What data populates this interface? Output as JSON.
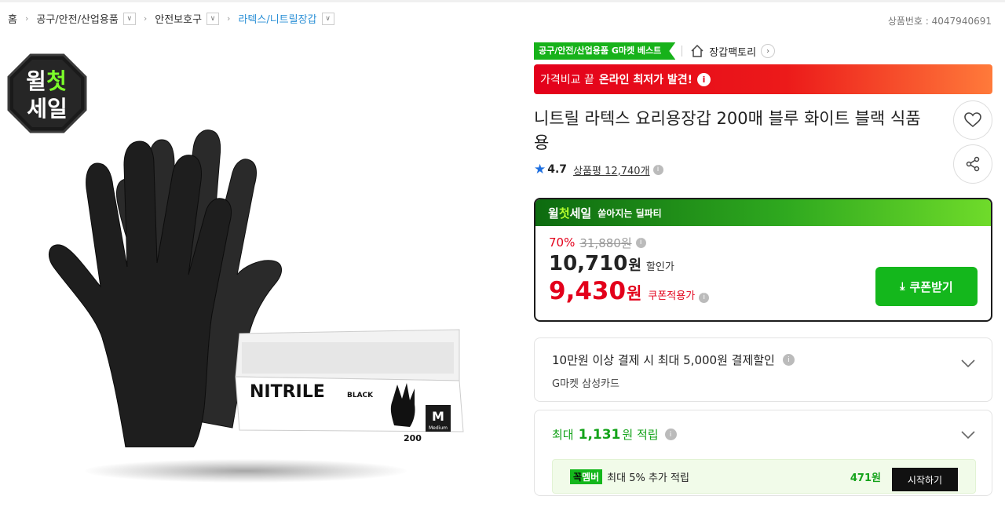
{
  "breadcrumb": {
    "home": "홈",
    "items": [
      {
        "label": "공구/안전/산업용품"
      },
      {
        "label": "안전보호구"
      },
      {
        "label": "라텍스/니트릴장갑"
      }
    ]
  },
  "product_no": "상품번호 : 4047940691",
  "badge": {
    "line1a": "윌",
    "line1b": "첫",
    "line2": "세일"
  },
  "box_label": {
    "brand": "NITRILE",
    "variant": "BLACK",
    "count": "200",
    "size": "M",
    "size_sub": "Medium"
  },
  "best_tag": "공구/안전/산업용품 G마켓 베스트",
  "store": {
    "name": "장갑팩토리"
  },
  "promo": {
    "text": "가격비교 끝",
    "bold": "온라인 최저가 발견!",
    "info": "i"
  },
  "title": "니트릴 라텍스 요리용장갑 200매 블루 화이트 블랙 식품용",
  "rating": {
    "score": "4.7",
    "review_label": "상품평",
    "review_count": "12,740개"
  },
  "price": {
    "head_w1": "윌",
    "head_w2": "첫",
    "head_w3": "세일",
    "head_sub": "쏟아지는 딜파티",
    "discount": "70%",
    "original": "31,880원",
    "sale": "10,710",
    "won": "원",
    "sale_label": "할인가",
    "coupon": "9,430",
    "coupon_label": "쿠폰적용가",
    "coupon_btn": "쿠폰받기"
  },
  "card_offer": {
    "title": "10만원 이상 결제 시 최대 5,000원 결제할인",
    "sub": "G마켓 삼성카드"
  },
  "points": {
    "prefix": "최대",
    "amount": "1,131",
    "suffix": "원 적립",
    "member_badge_a": "꼭",
    "member_badge_b": "멤버",
    "member_text": "최대 5% 추가 적립",
    "member_amount": "471원",
    "member_btn": "시작하기"
  },
  "colors": {
    "accent_green": "#14b71c",
    "promo_red": "#e3001b",
    "link_blue": "#2a8fd6"
  }
}
